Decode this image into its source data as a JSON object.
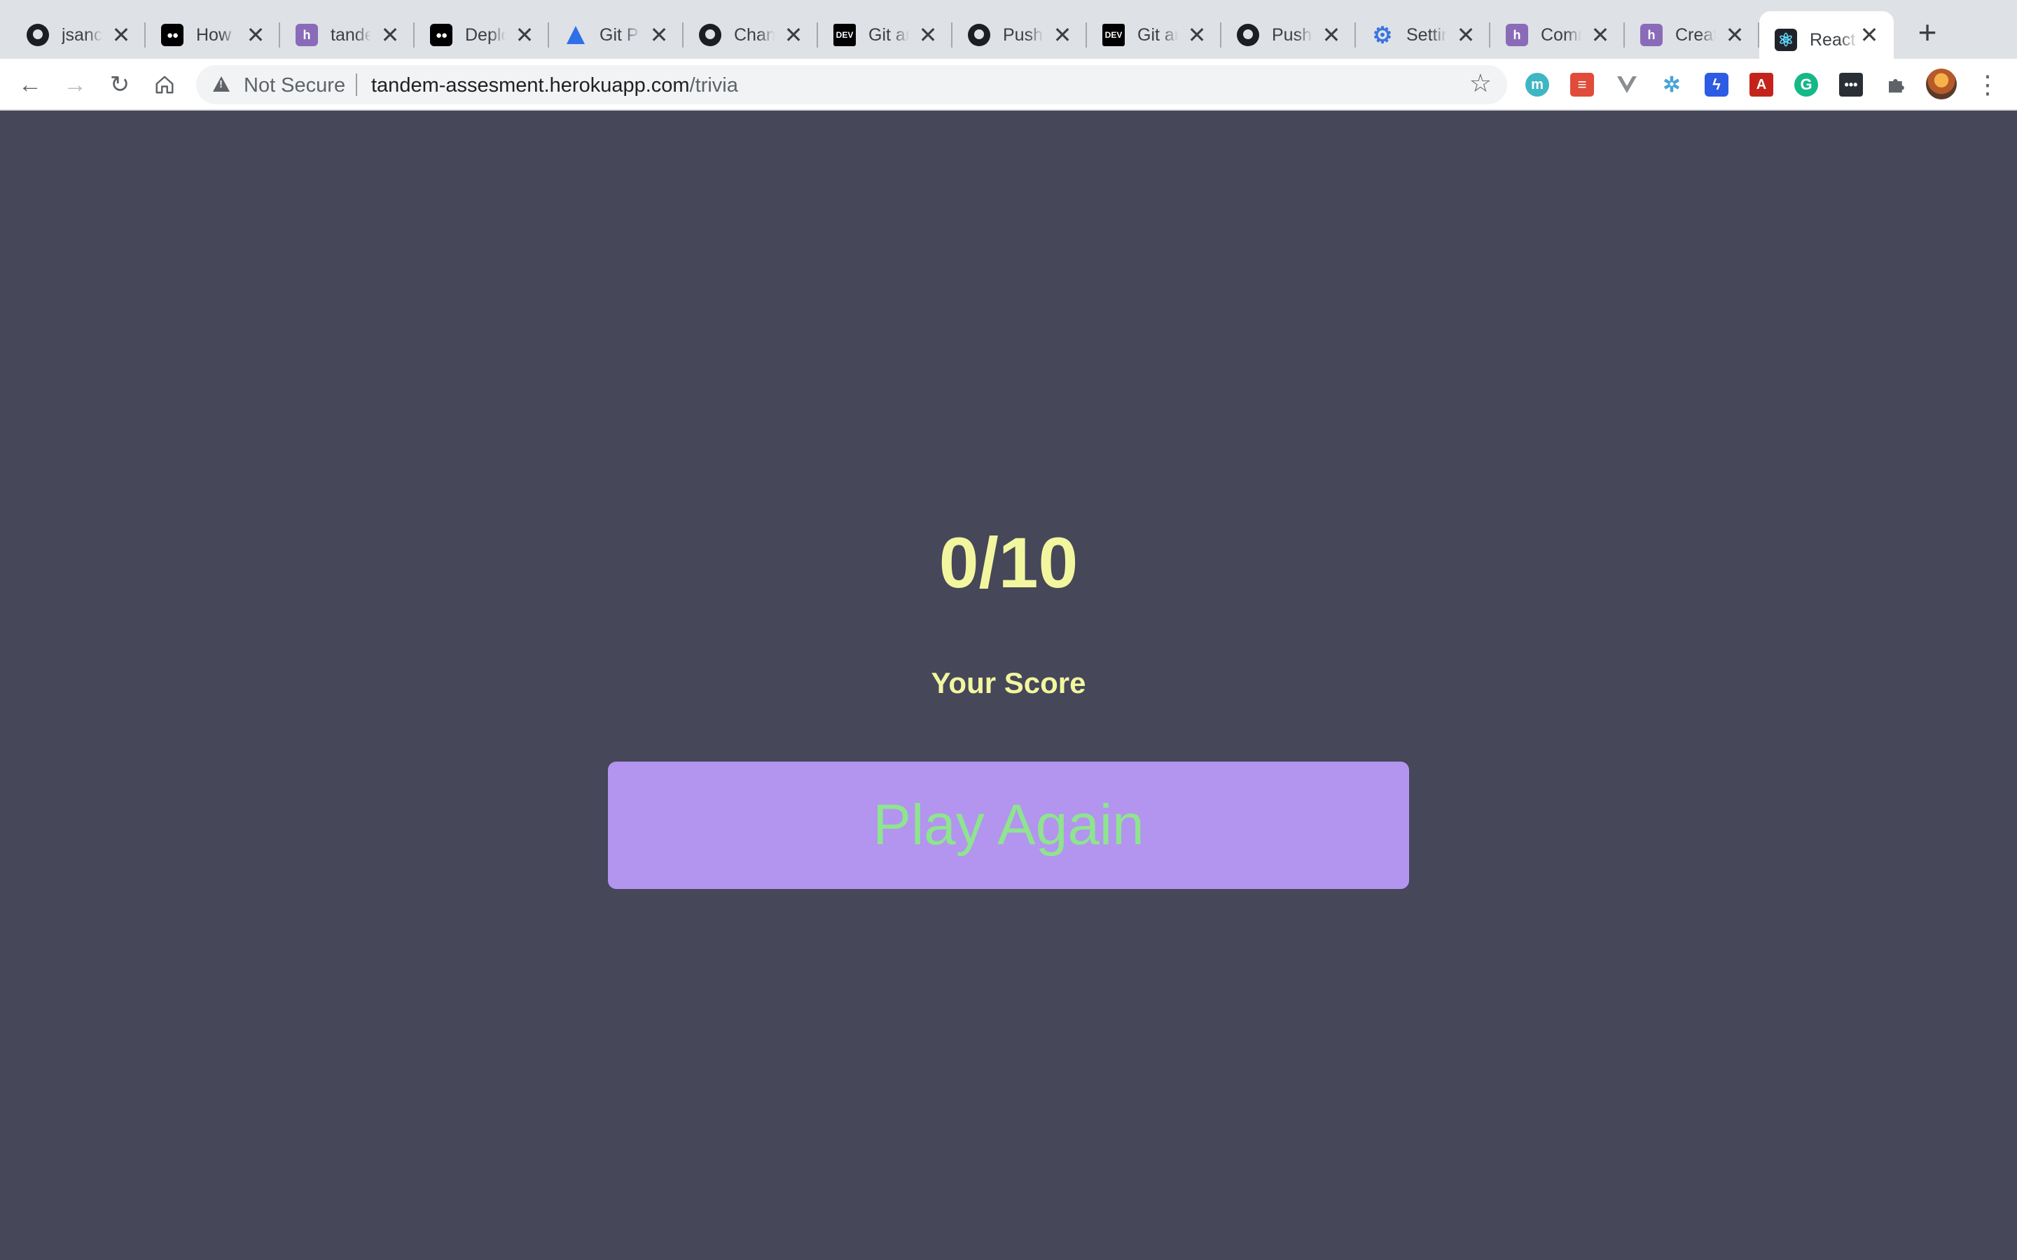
{
  "browser": {
    "tabs": [
      {
        "title": "jsanchez",
        "favicon": "github-icon",
        "active": false
      },
      {
        "title": "How to",
        "favicon": "medium-icon",
        "active": false
      },
      {
        "title": "tandem",
        "favicon": "heroku-icon",
        "active": false
      },
      {
        "title": "Deploy",
        "favicon": "medium-icon",
        "active": false
      },
      {
        "title": "Git Push",
        "favicon": "atlassian-icon",
        "active": false
      },
      {
        "title": "Change",
        "favicon": "github-icon",
        "active": false
      },
      {
        "title": "Git and",
        "favicon": "dev-icon",
        "active": false
      },
      {
        "title": "Pushing",
        "favicon": "github-icon",
        "active": false
      },
      {
        "title": "Git and",
        "favicon": "dev-icon",
        "active": false
      },
      {
        "title": "Pushing",
        "favicon": "github-icon",
        "active": false
      },
      {
        "title": "Settings",
        "favicon": "gear-icon",
        "active": false
      },
      {
        "title": "Commands",
        "favicon": "heroku-icon",
        "active": false
      },
      {
        "title": "Create",
        "favicon": "heroku-icon",
        "active": false
      },
      {
        "title": "React",
        "favicon": "react-icon",
        "active": true
      }
    ],
    "new_tab_symbol": "+",
    "close_symbol": "✕",
    "security_label": "Not Secure",
    "url_host": "tandem-assesment.herokuapp.com",
    "url_path": "/trivia",
    "extensions": [
      "m-icon",
      "todoist-icon",
      "vue-icon",
      "network-icon",
      "messenger-icon",
      "acrobat-icon",
      "grammarly-icon",
      "password-icon",
      "puzzle-icon"
    ]
  },
  "colors": {
    "page_bg": "#464759",
    "score_text": "#f2f79f",
    "button_bg": "#b394ef",
    "button_text": "#8ee48f"
  },
  "result": {
    "score": "0/10",
    "label": "Your Score",
    "button_label": "Play Again"
  }
}
